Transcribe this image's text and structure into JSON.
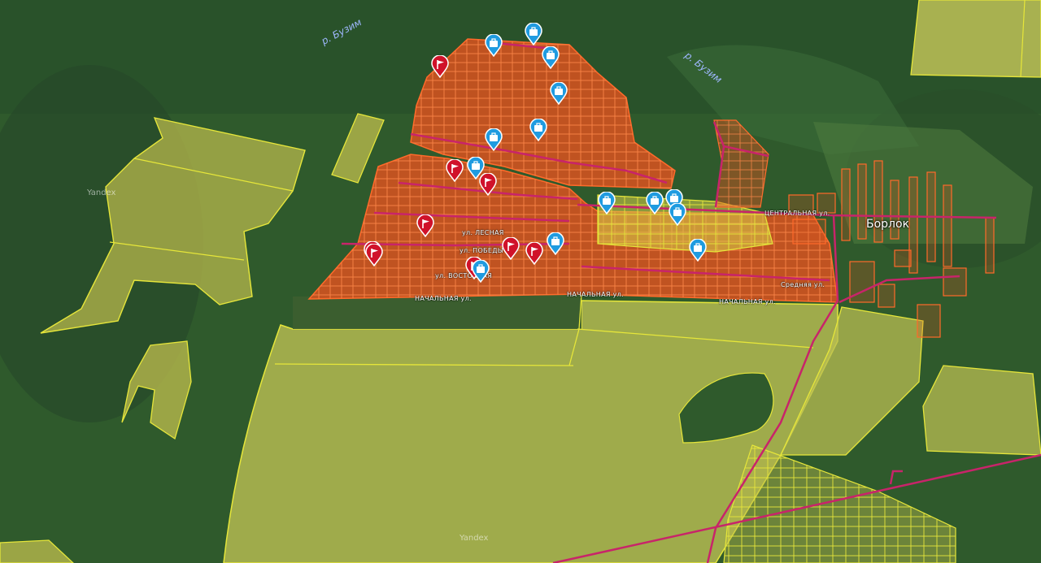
{
  "map": {
    "watermark": "Yandex",
    "labels": {
      "river_1": "р. Бузим",
      "river_2": "р. Бузим",
      "settlement": "Борлок",
      "street_nachalnaya_1": "НАЧАЛЬНАЯ ул.",
      "street_nachalnaya_2": "НАЧАЛЬНАЯ ул.",
      "street_nachalnaya_3": "НАЧАЛЬНАЯ ул.",
      "street_tsentralnaya": "ЦЕНТРАЛЬНАЯ ул.",
      "street_srednyaya": "Средняя ул.",
      "street_pobedy": "ул. ПОБЕДЫ",
      "street_vostochnaya": "ул. ВОСТОЧНАЯ",
      "street_lesnaya": "ул. ЛЕСНАЯ"
    },
    "colors": {
      "forest": "#2e5a2b",
      "field": "#b8b84a",
      "parcel_outline": "#e6e63a",
      "development_fill": "#e0521f",
      "development_outline": "#ff6a2a",
      "road": "#c8246a",
      "pin_red": "#d0122a",
      "pin_blue": "#1f9be0"
    },
    "markers_red": [
      "flag-marker",
      "flag-marker",
      "flag-marker",
      "flag-marker",
      "flag-marker",
      "flag-marker",
      "flag-marker",
      "flag-marker",
      "flag-marker"
    ],
    "markers_blue": [
      "briefcase-marker",
      "briefcase-marker",
      "briefcase-marker",
      "briefcase-marker",
      "briefcase-marker",
      "briefcase-marker",
      "briefcase-marker",
      "briefcase-marker",
      "briefcase-marker",
      "briefcase-marker",
      "briefcase-marker",
      "briefcase-marker",
      "briefcase-marker",
      "briefcase-marker"
    ]
  }
}
